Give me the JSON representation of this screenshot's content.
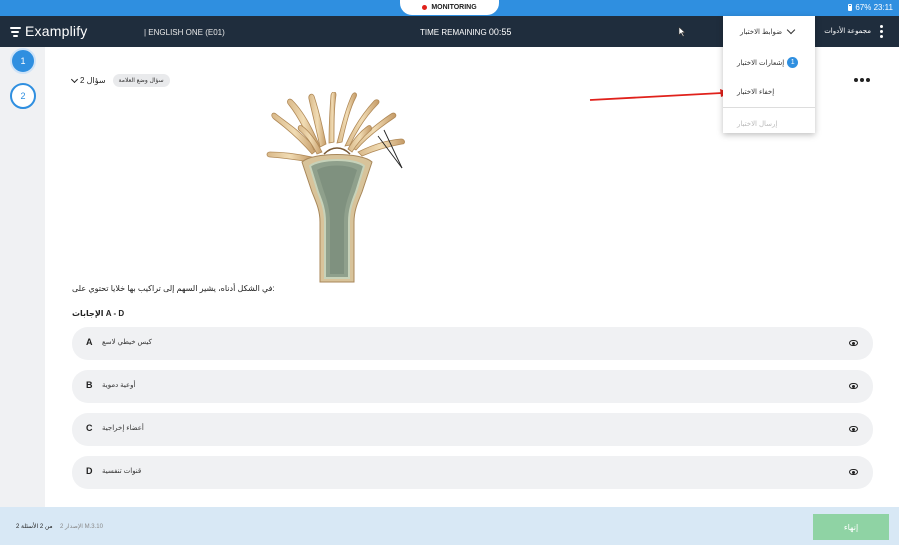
{
  "status_bar": {
    "monitoring": "MONITORING",
    "battery": "67% 23:11",
    "accent_color": "#2f8fe0"
  },
  "header": {
    "logo_text": "Examplify",
    "exam_name": "| ENGLISH ONE (E01)",
    "time_label": "TIME REMAINING",
    "time_value": "00:55",
    "tools_label": "مجموعة الأدوات"
  },
  "menu": {
    "title": "ضوابط الاختبار",
    "items": [
      {
        "label": "إشعارات الاختبار",
        "badge": "1"
      },
      {
        "label": "إخفاء الاختبار"
      },
      {
        "label": "إرسال الاختبار",
        "disabled": true
      }
    ]
  },
  "rail": {
    "questions": [
      "1",
      "2"
    ]
  },
  "question": {
    "number_label": "سؤال 2",
    "flag_label": "سؤال وضع العلامة",
    "stem": "في الشكل أدناه، يشير السهم إلى تراكيب بها خلايا تحتوي على:",
    "answers_label": "الإجابات A - D",
    "choices": [
      {
        "letter": "A",
        "text": "كيس خيطي لاسع"
      },
      {
        "letter": "B",
        "text": "أوعية دموية"
      },
      {
        "letter": "C",
        "text": "أعضاء إخراجية"
      },
      {
        "letter": "D",
        "text": "قنوات تنفسية"
      }
    ]
  },
  "footer": {
    "question_count": "من 2 الأسئلة 2",
    "version": "الإصدار 2 M.3.10",
    "finish_label": "إنهاء",
    "finish_color": "#8fd3a4"
  }
}
